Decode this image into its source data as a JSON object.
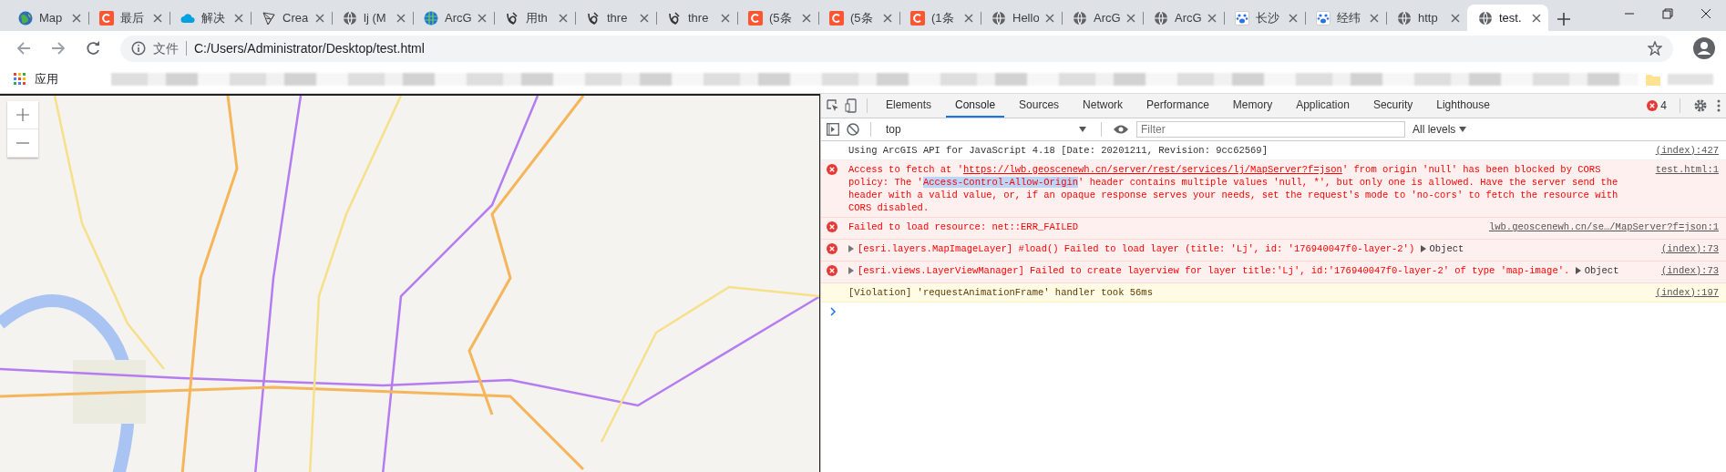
{
  "tabs": [
    {
      "title": "Map",
      "kind": "earth",
      "selected": false
    },
    {
      "title": "最后",
      "kind": "csdn",
      "selected": false
    },
    {
      "title": "解决",
      "kind": "cloud",
      "selected": false
    },
    {
      "title": "Crea",
      "kind": "mesh",
      "selected": false
    },
    {
      "title": "lj (M",
      "kind": "globe",
      "selected": false
    },
    {
      "title": "ArcG",
      "kind": "grid-globe",
      "selected": false
    },
    {
      "title": "用th",
      "kind": "swirl",
      "selected": false
    },
    {
      "title": "thre",
      "kind": "swirl",
      "selected": false
    },
    {
      "title": "thre",
      "kind": "swirl",
      "selected": false
    },
    {
      "title": "(5条",
      "kind": "csdn",
      "selected": false
    },
    {
      "title": "(5条",
      "kind": "csdn",
      "selected": false
    },
    {
      "title": "(1条",
      "kind": "csdn",
      "selected": false
    },
    {
      "title": "Hello",
      "kind": "globe",
      "selected": false
    },
    {
      "title": "ArcG",
      "kind": "globe",
      "selected": false
    },
    {
      "title": "ArcG",
      "kind": "globe",
      "selected": false
    },
    {
      "title": "长沙",
      "kind": "paw",
      "selected": false
    },
    {
      "title": "经纬",
      "kind": "paw",
      "selected": false
    },
    {
      "title": "http",
      "kind": "globe",
      "selected": false
    },
    {
      "title": "test.",
      "kind": "globe",
      "selected": true
    }
  ],
  "address_bar": {
    "security_label": "文件",
    "url": "C:/Users/Administrator/Desktop/test.html"
  },
  "bookmarks_bar": {
    "apps_label": "应用"
  },
  "devtools": {
    "tabs": [
      {
        "label": "Elements",
        "selected": false
      },
      {
        "label": "Console",
        "selected": true
      },
      {
        "label": "Sources",
        "selected": false
      },
      {
        "label": "Network",
        "selected": false
      },
      {
        "label": "Performance",
        "selected": false
      },
      {
        "label": "Memory",
        "selected": false
      },
      {
        "label": "Application",
        "selected": false
      },
      {
        "label": "Security",
        "selected": false
      },
      {
        "label": "Lighthouse",
        "selected": false
      }
    ],
    "error_count": "4",
    "context": "top",
    "filter_placeholder": "Filter",
    "levels": "All levels",
    "messages": [
      {
        "kind": "log",
        "expandable": false,
        "parts": [
          {
            "kind": "text",
            "text": "Using ArcGIS API for JavaScript 4.18 [Date: 20201211, Revision: 9cc62569]"
          }
        ],
        "source": "(index):427"
      },
      {
        "kind": "error",
        "expandable": false,
        "parts": [
          {
            "kind": "text",
            "text": "Access to fetch at '"
          },
          {
            "kind": "link",
            "text": "https://lwb.geoscenewh.cn/server/rest/services/lj/MapServer?f=json"
          },
          {
            "kind": "text",
            "text": "' from origin 'null' has been blocked by CORS policy: The '"
          },
          {
            "kind": "selected",
            "text": "Access-Control-Allow-Origin"
          },
          {
            "kind": "text",
            "text": "' header contains multiple values 'null, *', but only one is allowed. Have the server send the header with a valid value, or, if an opaque response serves your needs, set the request's mode to 'no-cors' to fetch the resource with CORS disabled."
          }
        ],
        "source": "test.html:1"
      },
      {
        "kind": "error",
        "expandable": false,
        "parts": [
          {
            "kind": "text",
            "text": "Failed to load resource: net::ERR_FAILED"
          }
        ],
        "source": "lwb.geoscenewh.cn/se…/MapServer?f=json:1"
      },
      {
        "kind": "error",
        "expandable": true,
        "parts": [
          {
            "kind": "text",
            "text": "[esri.layers.MapImageLayer] #load() Failed to load layer (title: 'Lj', id: '176940047f0-layer-2')"
          }
        ],
        "object": "Object",
        "source": "(index):73"
      },
      {
        "kind": "error",
        "expandable": true,
        "parts": [
          {
            "kind": "text",
            "text": "[esri.views.LayerViewManager] Failed to create layerview for layer title:'Lj', id:'176940047f0-layer-2' of type 'map-image'."
          }
        ],
        "object": "Object",
        "source": "(index):73"
      },
      {
        "kind": "violation",
        "expandable": false,
        "parts": [
          {
            "kind": "text",
            "text": "[Violation] 'requestAnimationFrame' handler took 56ms"
          }
        ],
        "source": "(index):197"
      }
    ]
  }
}
